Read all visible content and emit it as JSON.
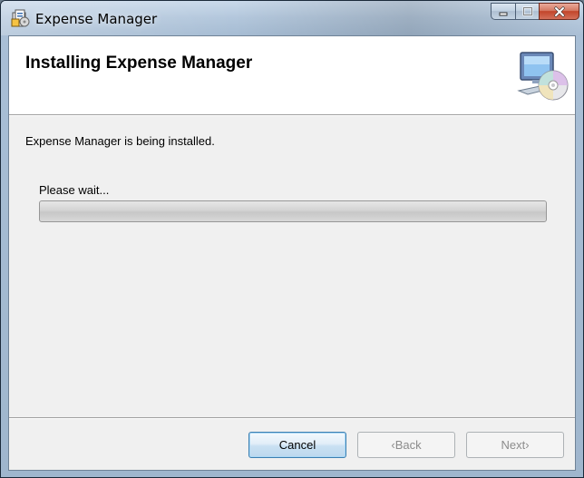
{
  "window": {
    "title": "Expense Manager",
    "icon": "installer-package-icon"
  },
  "header": {
    "title": "Installing Expense Manager",
    "graphic": "computer-with-cd-icon"
  },
  "body": {
    "status": "Expense Manager is being installed.",
    "wait_label": "Please wait...",
    "progress_fraction": 0
  },
  "buttons": {
    "cancel": "Cancel",
    "back_arrow": "‹",
    "back": "Back",
    "next": "Next",
    "next_arrow": "›"
  },
  "colors": {
    "close_button": "#c2452a",
    "default_button_border": "#3c7fb1"
  }
}
